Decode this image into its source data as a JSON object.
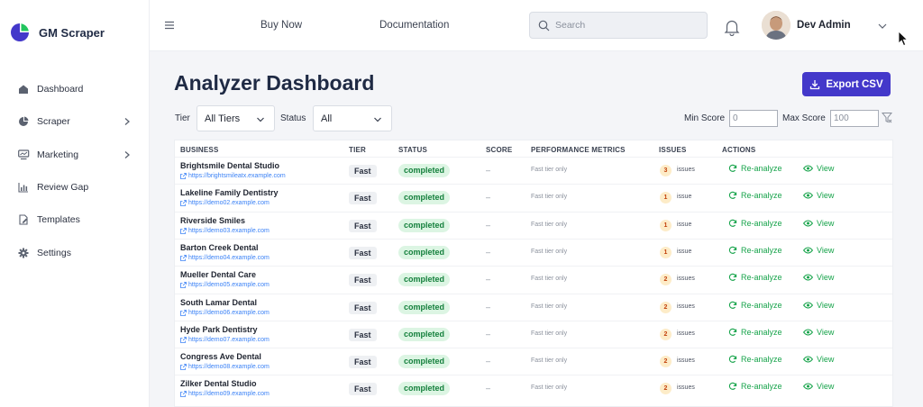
{
  "app": {
    "name": "GM Scraper"
  },
  "sidebar": {
    "items": [
      {
        "label": "Dashboard",
        "icon": "home-icon",
        "has_children": false
      },
      {
        "label": "Scraper",
        "icon": "pie-icon",
        "has_children": true
      },
      {
        "label": "Marketing",
        "icon": "marketing-icon",
        "has_children": true
      },
      {
        "label": "Review Gap",
        "icon": "bar-chart-icon",
        "has_children": false
      },
      {
        "label": "Templates",
        "icon": "template-icon",
        "has_children": false
      },
      {
        "label": "Settings",
        "icon": "gear-icon",
        "has_children": false
      }
    ]
  },
  "topbar": {
    "links": [
      "Buy Now",
      "Documentation"
    ],
    "search_placeholder": "Search",
    "user_name": "Dev Admin"
  },
  "page": {
    "title": "Analyzer Dashboard",
    "export_label": "Export CSV"
  },
  "filters": {
    "tier_label": "Tier",
    "tier_value": "All Tiers",
    "status_label": "Status",
    "status_value": "All",
    "min_score_label": "Min Score",
    "min_score_placeholder": "0",
    "max_score_label": "Max Score",
    "max_score_placeholder": "100"
  },
  "table": {
    "columns": [
      "BUSINESS",
      "TIER",
      "STATUS",
      "SCORE",
      "PERFORMANCE METRICS",
      "ISSUES",
      "ACTIONS"
    ],
    "reanalyze_label": "Re-analyze",
    "view_label": "View",
    "rows": [
      {
        "name": "Brightsmile Dental Studio",
        "url": "https://brightsmileatx.example.com",
        "tier": "Fast",
        "status": "completed",
        "score": "–",
        "perf": "Fast tier only",
        "issues": "3",
        "issues_label": "issues"
      },
      {
        "name": "Lakeline Family Dentistry",
        "url": "https://demo02.example.com",
        "tier": "Fast",
        "status": "completed",
        "score": "–",
        "perf": "Fast tier only",
        "issues": "1",
        "issues_label": "issue"
      },
      {
        "name": "Riverside Smiles",
        "url": "https://demo03.example.com",
        "tier": "Fast",
        "status": "completed",
        "score": "–",
        "perf": "Fast tier only",
        "issues": "1",
        "issues_label": "issue"
      },
      {
        "name": "Barton Creek Dental",
        "url": "https://demo04.example.com",
        "tier": "Fast",
        "status": "completed",
        "score": "–",
        "perf": "Fast tier only",
        "issues": "1",
        "issues_label": "issue"
      },
      {
        "name": "Mueller Dental Care",
        "url": "https://demo05.example.com",
        "tier": "Fast",
        "status": "completed",
        "score": "–",
        "perf": "Fast tier only",
        "issues": "2",
        "issues_label": "issues"
      },
      {
        "name": "South Lamar Dental",
        "url": "https://demo06.example.com",
        "tier": "Fast",
        "status": "completed",
        "score": "–",
        "perf": "Fast tier only",
        "issues": "2",
        "issues_label": "issues"
      },
      {
        "name": "Hyde Park Dentistry",
        "url": "https://demo07.example.com",
        "tier": "Fast",
        "status": "completed",
        "score": "–",
        "perf": "Fast tier only",
        "issues": "2",
        "issues_label": "issues"
      },
      {
        "name": "Congress Ave Dental",
        "url": "https://demo08.example.com",
        "tier": "Fast",
        "status": "completed",
        "score": "–",
        "perf": "Fast tier only",
        "issues": "2",
        "issues_label": "issues"
      },
      {
        "name": "Zilker Dental Studio",
        "url": "https://demo09.example.com",
        "tier": "Fast",
        "status": "completed",
        "score": "–",
        "perf": "Fast tier only",
        "issues": "2",
        "issues_label": "issues"
      }
    ]
  },
  "colors": {
    "brand": "#4338ca",
    "success": "#16a34a",
    "link": "#3b82f6",
    "issue_badge": "#fdecc8"
  }
}
